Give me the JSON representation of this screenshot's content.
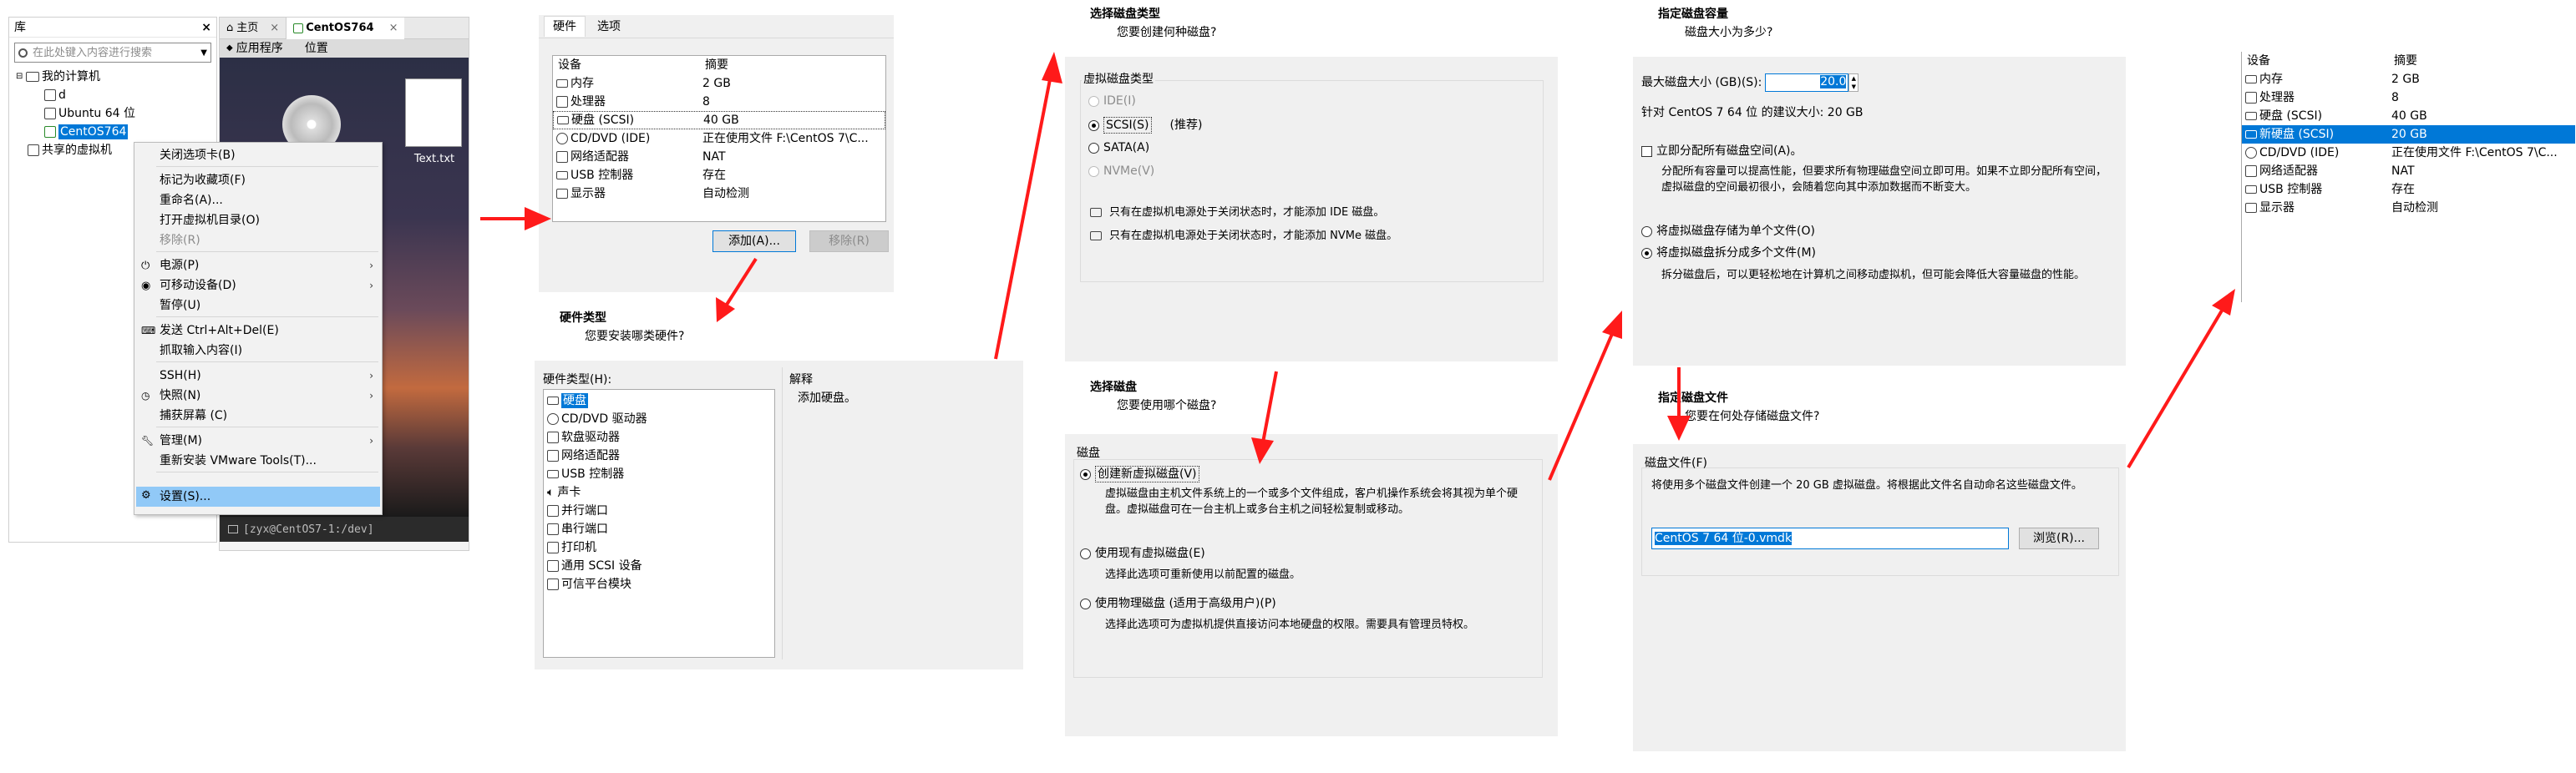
{
  "library": {
    "title": "库",
    "close": "×",
    "search_placeholder": "在此处键入内容进行搜索",
    "tree": [
      "我的计算机",
      "d",
      "Ubuntu 64 位",
      "CentOS764",
      "共享的虚拟机"
    ]
  },
  "vm_window": {
    "tabs": [
      "主页",
      "CentOS764"
    ],
    "tab_close": "×",
    "menu": [
      "应用程序",
      "位置"
    ],
    "desktop_file": "Text.txt",
    "status": "[zyx@CentOS7-1:/dev]"
  },
  "context_menu": {
    "items": [
      "关闭选项卡(B)",
      "标记为收藏项(F)",
      "重命名(A)...",
      "打开虚拟机目录(O)",
      "移除(R)",
      "电源(P)",
      "可移动设备(D)",
      "暂停(U)",
      "发送 Ctrl+Alt+Del(E)",
      "抓取输入内容(I)",
      "SSH(H)",
      "快照(N)",
      "捕获屏幕 (C)",
      "管理(M)",
      "重新安装 VMware Tools(T)...",
      "设置(S)..."
    ]
  },
  "settings1": {
    "tabs": [
      "硬件",
      "选项"
    ],
    "col_device": "设备",
    "col_summary": "摘要",
    "rows": [
      {
        "device": "内存",
        "summary": "2 GB"
      },
      {
        "device": "处理器",
        "summary": "8"
      },
      {
        "device": "硬盘 (SCSI)",
        "summary": "40 GB"
      },
      {
        "device": "CD/DVD (IDE)",
        "summary": "正在使用文件 F:\\CentOS 7\\C..."
      },
      {
        "device": "网络适配器",
        "summary": "NAT"
      },
      {
        "device": "USB 控制器",
        "summary": "存在"
      },
      {
        "device": "显示器",
        "summary": "自动检测"
      }
    ],
    "add_button": "添加(A)...",
    "remove_button": "移除(R)"
  },
  "hw_type": {
    "title": "硬件类型",
    "subtitle": "您要安装哪类硬件?",
    "list_label": "硬件类型(H):",
    "explain_label": "解释",
    "explain_text": "添加硬盘。",
    "items": [
      "硬盘",
      "CD/DVD 驱动器",
      "软盘驱动器",
      "网络适配器",
      "USB 控制器",
      "声卡",
      "并行端口",
      "串行端口",
      "打印机",
      "通用 SCSI 设备",
      "可信平台模块"
    ]
  },
  "disk_type": {
    "title": "选择磁盘类型",
    "subtitle": "您要创建何种磁盘?",
    "group_label": "虚拟磁盘类型",
    "options": [
      "IDE(I)",
      "SCSI(S)",
      "SATA(A)",
      "NVMe(V)"
    ],
    "recommended": "(推荐)",
    "note1": "只有在虚拟机电源处于关闭状态时，才能添加 IDE 磁盘。",
    "note2": "只有在虚拟机电源处于关闭状态时，才能添加 NVMe 磁盘。"
  },
  "select_disk": {
    "title": "选择磁盘",
    "subtitle": "您要使用哪个磁盘?",
    "group_label": "磁盘",
    "opt1": "创建新虚拟磁盘(V)",
    "opt1_desc": "虚拟磁盘由主机文件系统上的一个或多个文件组成，客户机操作系统会将其视为单个硬盘。虚拟磁盘可在一台主机上或多台主机之间轻松复制或移动。",
    "opt2": "使用现有虚拟磁盘(E)",
    "opt2_desc": "选择此选项可重新使用以前配置的磁盘。",
    "opt3": "使用物理磁盘 (适用于高级用户)(P)",
    "opt3_desc": "选择此选项可为虚拟机提供直接访问本地硬盘的权限。需要具有管理员特权。"
  },
  "capacity": {
    "title": "指定磁盘容量",
    "subtitle": "磁盘大小为多少?",
    "max_label": "最大磁盘大小 (GB)(S):",
    "max_value": "20.0",
    "recommend": "针对 CentOS 7 64 位 的建议大小: 20 GB",
    "alloc_label": "立即分配所有磁盘空间(A)。",
    "alloc_desc": "分配所有容量可以提高性能，但要求所有物理磁盘空间立即可用。如果不立即分配所有空间，虚拟磁盘的空间最初很小，会随着您向其中添加数据而不断变大。",
    "single_file": "将虚拟磁盘存储为单个文件(O)",
    "multi_file": "将虚拟磁盘拆分成多个文件(M)",
    "multi_desc": "拆分磁盘后，可以更轻松地在计算机之间移动虚拟机，但可能会降低大容量磁盘的性能。"
  },
  "disk_file": {
    "title": "指定磁盘文件",
    "subtitle": "您要在何处存储磁盘文件?",
    "group_label": "磁盘文件(F)",
    "desc": "将使用多个磁盘文件创建一个 20 GB 虚拟磁盘。将根据此文件名自动命名这些磁盘文件。",
    "file_value": "CentOS 7 64 位-0.vmdk",
    "browse_button": "浏览(R)..."
  },
  "settings2": {
    "col_device": "设备",
    "col_summary": "摘要",
    "rows": [
      {
        "device": "内存",
        "summary": "2 GB"
      },
      {
        "device": "处理器",
        "summary": "8"
      },
      {
        "device": "硬盘 (SCSI)",
        "summary": "40 GB"
      },
      {
        "device": "新硬盘 (SCSI)",
        "summary": "20 GB"
      },
      {
        "device": "CD/DVD (IDE)",
        "summary": "正在使用文件 F:\\CentOS 7\\C..."
      },
      {
        "device": "网络适配器",
        "summary": "NAT"
      },
      {
        "device": "USB 控制器",
        "summary": "存在"
      },
      {
        "device": "显示器",
        "summary": "自动检测"
      }
    ]
  },
  "colors": {
    "arrow": "#ff1a1a",
    "selection": "#0078d7",
    "panel": "#f0f0f0"
  }
}
